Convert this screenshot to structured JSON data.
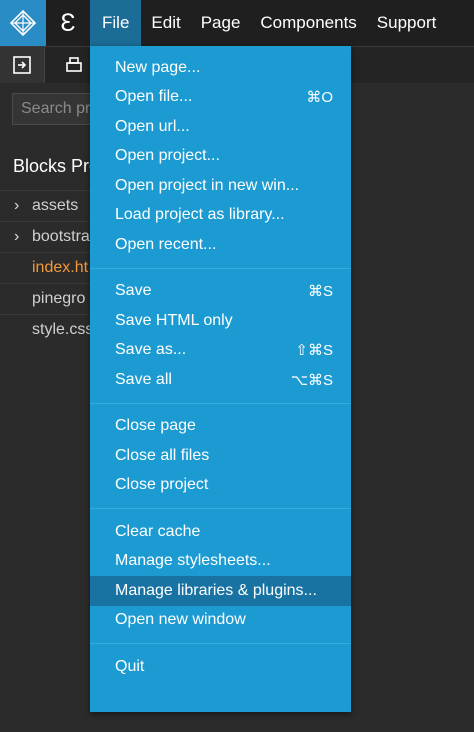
{
  "menubar": {
    "logo_icon": "pinecone-logo-icon",
    "secondary_icon": "E-letter-icon",
    "menus": [
      "File",
      "Edit",
      "Page",
      "Components",
      "Support"
    ],
    "active_menu": "File",
    "accent": "#2a8cc4"
  },
  "toolbar": {
    "buttons": [
      "export-icon",
      "printer-icon"
    ]
  },
  "search": {
    "placeholder": "Search pr"
  },
  "panel": {
    "title": "Blocks Pro",
    "tree": [
      {
        "label": "assets",
        "chevron": true
      },
      {
        "label": "bootstra",
        "chevron": true
      },
      {
        "label": "index.ht",
        "chevron": false,
        "active": true
      },
      {
        "label": "pinegro",
        "chevron": false
      },
      {
        "label": "style.css",
        "chevron": false
      }
    ]
  },
  "file_menu": {
    "bg": "#1c9bd2",
    "groups": [
      [
        {
          "label": "New page...",
          "shortcut": ""
        },
        {
          "label": "Open file...",
          "shortcut": "⌘O"
        },
        {
          "label": "Open url...",
          "shortcut": ""
        },
        {
          "label": "Open project...",
          "shortcut": ""
        },
        {
          "label": "Open project in new win...",
          "shortcut": ""
        },
        {
          "label": "Load project as library...",
          "shortcut": ""
        },
        {
          "label": "Open recent...",
          "shortcut": ""
        }
      ],
      [
        {
          "label": "Save",
          "shortcut": "⌘S"
        },
        {
          "label": "Save HTML only",
          "shortcut": ""
        },
        {
          "label": "Save as...",
          "shortcut": "⇧⌘S"
        },
        {
          "label": "Save all",
          "shortcut": "⌥⌘S"
        }
      ],
      [
        {
          "label": "Close page",
          "shortcut": ""
        },
        {
          "label": "Close all files",
          "shortcut": ""
        },
        {
          "label": "Close project",
          "shortcut": ""
        }
      ],
      [
        {
          "label": "Clear cache",
          "shortcut": ""
        },
        {
          "label": "Manage stylesheets...",
          "shortcut": ""
        },
        {
          "label": "Manage libraries & plugins...",
          "shortcut": "",
          "hover": true
        },
        {
          "label": "Open new window",
          "shortcut": ""
        }
      ],
      [
        {
          "label": "Quit",
          "shortcut": ""
        }
      ]
    ]
  }
}
